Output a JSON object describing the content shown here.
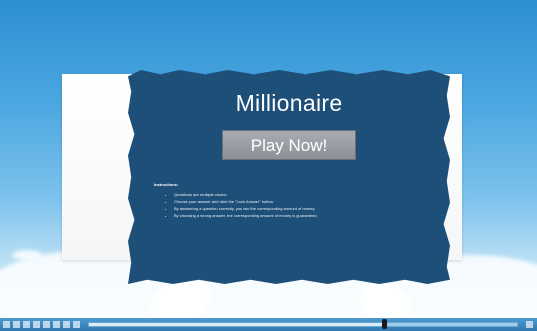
{
  "game": {
    "title": "Millionaire",
    "play_label": "Play Now!",
    "instructions": {
      "heading": "Instructions:",
      "items": [
        "Questions are multiple choice.",
        "Choose your answer and click the \"Lock Answer\" button.",
        "By answering a question correctly, you win the corresponding amount of money.",
        "By choosing a wrong answer, the corresponding amount of money is guaranteed."
      ]
    }
  },
  "player": {
    "progress": 0.69,
    "icons": [
      "back-icon",
      "play-icon",
      "stop-icon",
      "rewind-icon",
      "forward-icon",
      "volume-icon",
      "settings-icon",
      "fullscreen-icon"
    ]
  },
  "colors": {
    "sky_top": "#2c8fd1",
    "panel": "#1d4f79",
    "button": "#9a9ea4",
    "control_bar": "#3f89c2"
  }
}
